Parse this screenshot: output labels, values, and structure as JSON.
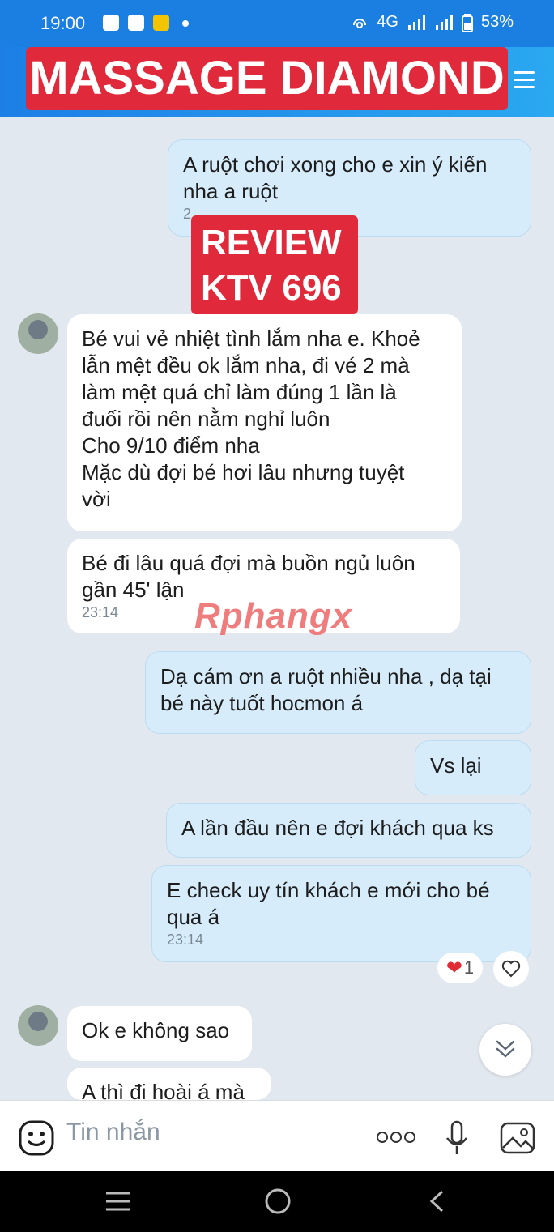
{
  "status_bar": {
    "time": "19:00",
    "network": "4G",
    "battery": "53%"
  },
  "header": {
    "title": "MASSAGE DIAMOND"
  },
  "overlay": {
    "review_line1": "REVIEW",
    "review_line2": "KTV 696",
    "watermark": "Rphangx"
  },
  "messages": [
    {
      "side": "out",
      "text_line1": "A ruột chơi xong cho e xin ý kiến",
      "text_line2": "nha a ruột",
      "time": "2"
    },
    {
      "side": "in",
      "lines": [
        "Bé vui vẻ nhiệt tình lắm nha e. Khoẻ",
        "lẫn mệt đều ok lắm nha, đi vé 2 mà",
        "làm mệt quá chỉ làm đúng 1 lần là",
        "đuối rồi nên nằm nghỉ luôn",
        "Cho 9/10 điểm nha",
        "Mặc dù đợi bé hơi lâu nhưng tuyệt",
        "vời"
      ]
    },
    {
      "side": "in",
      "lines": [
        "Bé đi lâu quá đợi mà buồn ngủ luôn",
        "gần 45' lận"
      ],
      "time": "23:14"
    },
    {
      "side": "out",
      "lines": [
        "Dạ cám ơn a ruột nhiều nha , dạ tại",
        "bé này tuốt hocmon á"
      ]
    },
    {
      "side": "out",
      "lines": [
        "Vs lại"
      ]
    },
    {
      "side": "out",
      "lines": [
        "A lần đầu nên e đợi khách qua ks"
      ]
    },
    {
      "side": "out",
      "lines": [
        "E check uy tín khách e mới cho bé",
        "qua á"
      ],
      "time": "23:14"
    },
    {
      "side": "in",
      "lines": [
        "Ok e không sao"
      ]
    },
    {
      "side": "in",
      "lines": [
        "A thì đi hoài á mà"
      ]
    }
  ],
  "reaction": {
    "count": "1"
  },
  "composer": {
    "placeholder": "Tin nhắn"
  },
  "colors": {
    "header": "#1a7fe0",
    "banner": "#e0293a",
    "outgoing": "#d6ecfb",
    "incoming": "#ffffff",
    "background": "#e2e8ef"
  }
}
